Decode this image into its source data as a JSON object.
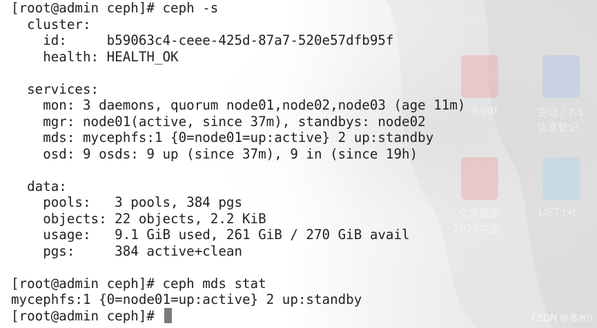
{
  "terminal": {
    "lines": [
      "[root@admin ceph]# ceph -s",
      "  cluster:",
      "    id:     b59063c4-ceee-425d-87a7-520e57dfb95f",
      "    health: HEALTH_OK",
      "",
      "  services:",
      "    mon: 3 daemons, quorum node01,node02,node03 (age 11m)",
      "    mgr: node01(active, since 37m), standbys: node02",
      "    mds: mycephfs:1 {0=node01=up:active} 2 up:standby",
      "    osd: 9 osds: 9 up (since 37m), 9 in (since 19h)",
      "",
      "  data:",
      "    pools:   3 pools, 384 pgs",
      "    objects: 22 objects, 2.2 KiB",
      "    usage:   9.1 GiB used, 261 GiB / 270 GiB avail",
      "    pgs:     384 active+clean",
      "",
      "[root@admin ceph]# ceph mds stat",
      "mycephfs:1 {0=node01=up:active} 2 up:standby",
      "[root@admin ceph]# "
    ]
  },
  "desktop": {
    "icon_labels": [
      "- 3.pdf",
      "变动 / 7.1",
      "信息登记",
      "文学期曲",
      "2022学业",
      "LIST.txt"
    ]
  },
  "watermark": "CSDN @墨水\\\\"
}
